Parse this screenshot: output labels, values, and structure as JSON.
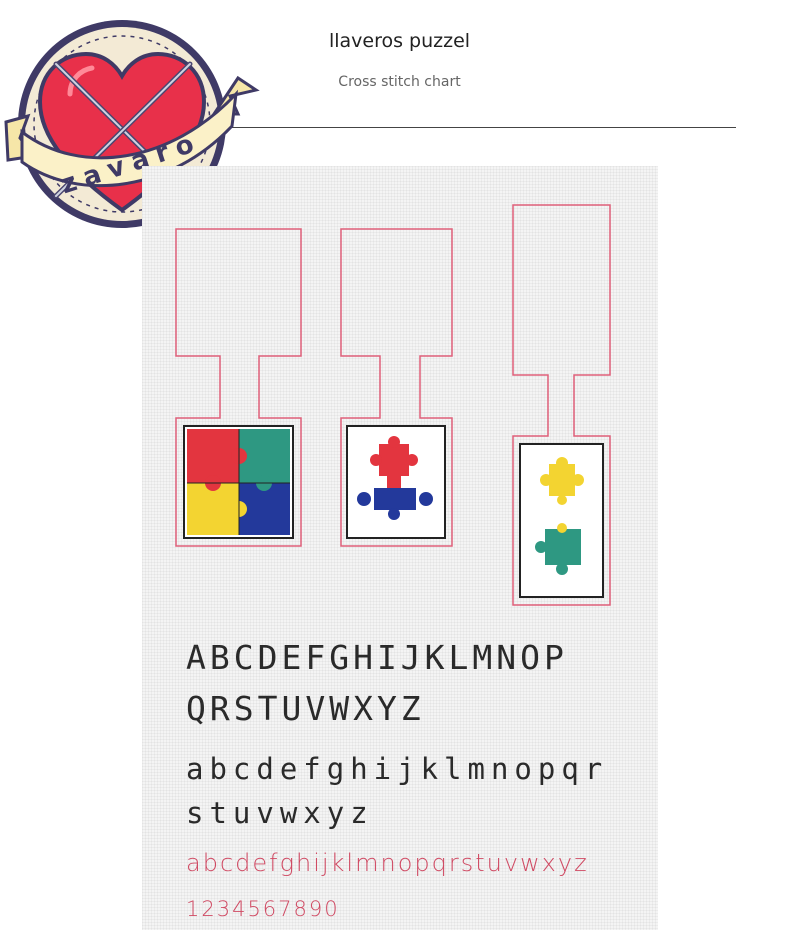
{
  "header": {
    "title": "llaveros puzzel",
    "subtitle": "Cross stitch chart"
  },
  "logo": {
    "text": "zavaro",
    "colors": {
      "heart": "#e8304a",
      "ribbon": "#fbf1c8",
      "outline": "#3f3a66",
      "ring": "#f3ead5"
    }
  },
  "keychains": [
    {
      "pieces": [
        "red",
        "teal",
        "yellow",
        "blue"
      ]
    },
    {
      "pieces": [
        "red",
        "blue"
      ]
    },
    {
      "pieces": [
        "yellow",
        "teal"
      ]
    }
  ],
  "alphabet": {
    "upper_line1": "ABCDEFGHIJKLMNOP",
    "upper_line2": "QRSTUVWXYZ",
    "lower_line1": "abcdefghijklmnopqr",
    "lower_line2": "stuvwxyz",
    "backstitch_lower": "abcdefghijklmnopqrstuvwxyz",
    "digits": "1234567890"
  },
  "colors": {
    "outline": "#e0607a",
    "frame": "#222222",
    "red": "#e3353f",
    "teal": "#2e9882",
    "yellow": "#f3d431",
    "blue": "#23399b",
    "text_pink": "#d04a63"
  }
}
